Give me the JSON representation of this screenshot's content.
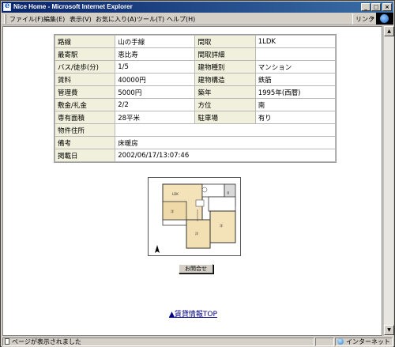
{
  "window": {
    "title": "Nice Home - Microsoft Internet Explorer",
    "controls": [
      "_",
      "□",
      "×"
    ]
  },
  "menu": {
    "items": [
      "ファイル(F)",
      "編集(E)",
      "表示(V)",
      "お気に入り(A)",
      "ツール(T)",
      "ヘルプ(H)"
    ],
    "links_label": "リンク",
    "links_chevron": "»"
  },
  "property": {
    "rows": [
      {
        "l1": "路線",
        "v1": "山の手線",
        "l2": "間取",
        "v2": "1LDK"
      },
      {
        "l1": "最寄駅",
        "v1": "恵比寿",
        "l2": "間取詳細",
        "v2": ""
      },
      {
        "l1": "バス/徒歩(分)",
        "v1": "1/5",
        "l2": "建物種別",
        "v2": "マンション"
      },
      {
        "l1": "賃料",
        "v1": "40000円",
        "l2": "建物構造",
        "v2": "鉄筋"
      },
      {
        "l1": "管理費",
        "v1": "5000円",
        "l2": "築年",
        "v2": "1995年(西暦)"
      },
      {
        "l1": "敷金/礼金",
        "v1": "2/2",
        "l2": "方位",
        "v2": "南"
      },
      {
        "l1": "専有面積",
        "v1": "28平米",
        "l2": "駐車場",
        "v2": "有り"
      }
    ],
    "address_label": "物件住所",
    "address_value": "",
    "notes_label": "備考",
    "notes_value": "床暖房",
    "posted_label": "掲載日",
    "posted_value": "2002/06/17/13:07:46"
  },
  "buttons": {
    "inquiry": "お問合せ"
  },
  "links": {
    "back_triangle": "▲",
    "back_top": "賃貸情報TOP"
  },
  "status": {
    "message": "ページが表示されました",
    "zone": "インターネット"
  },
  "icons": [
    "ie-app-icon",
    "ie-logo-icon",
    "page-icon",
    "globe-icon",
    "north-arrow-icon",
    "scroll-up-icon",
    "scroll-down-icon"
  ]
}
